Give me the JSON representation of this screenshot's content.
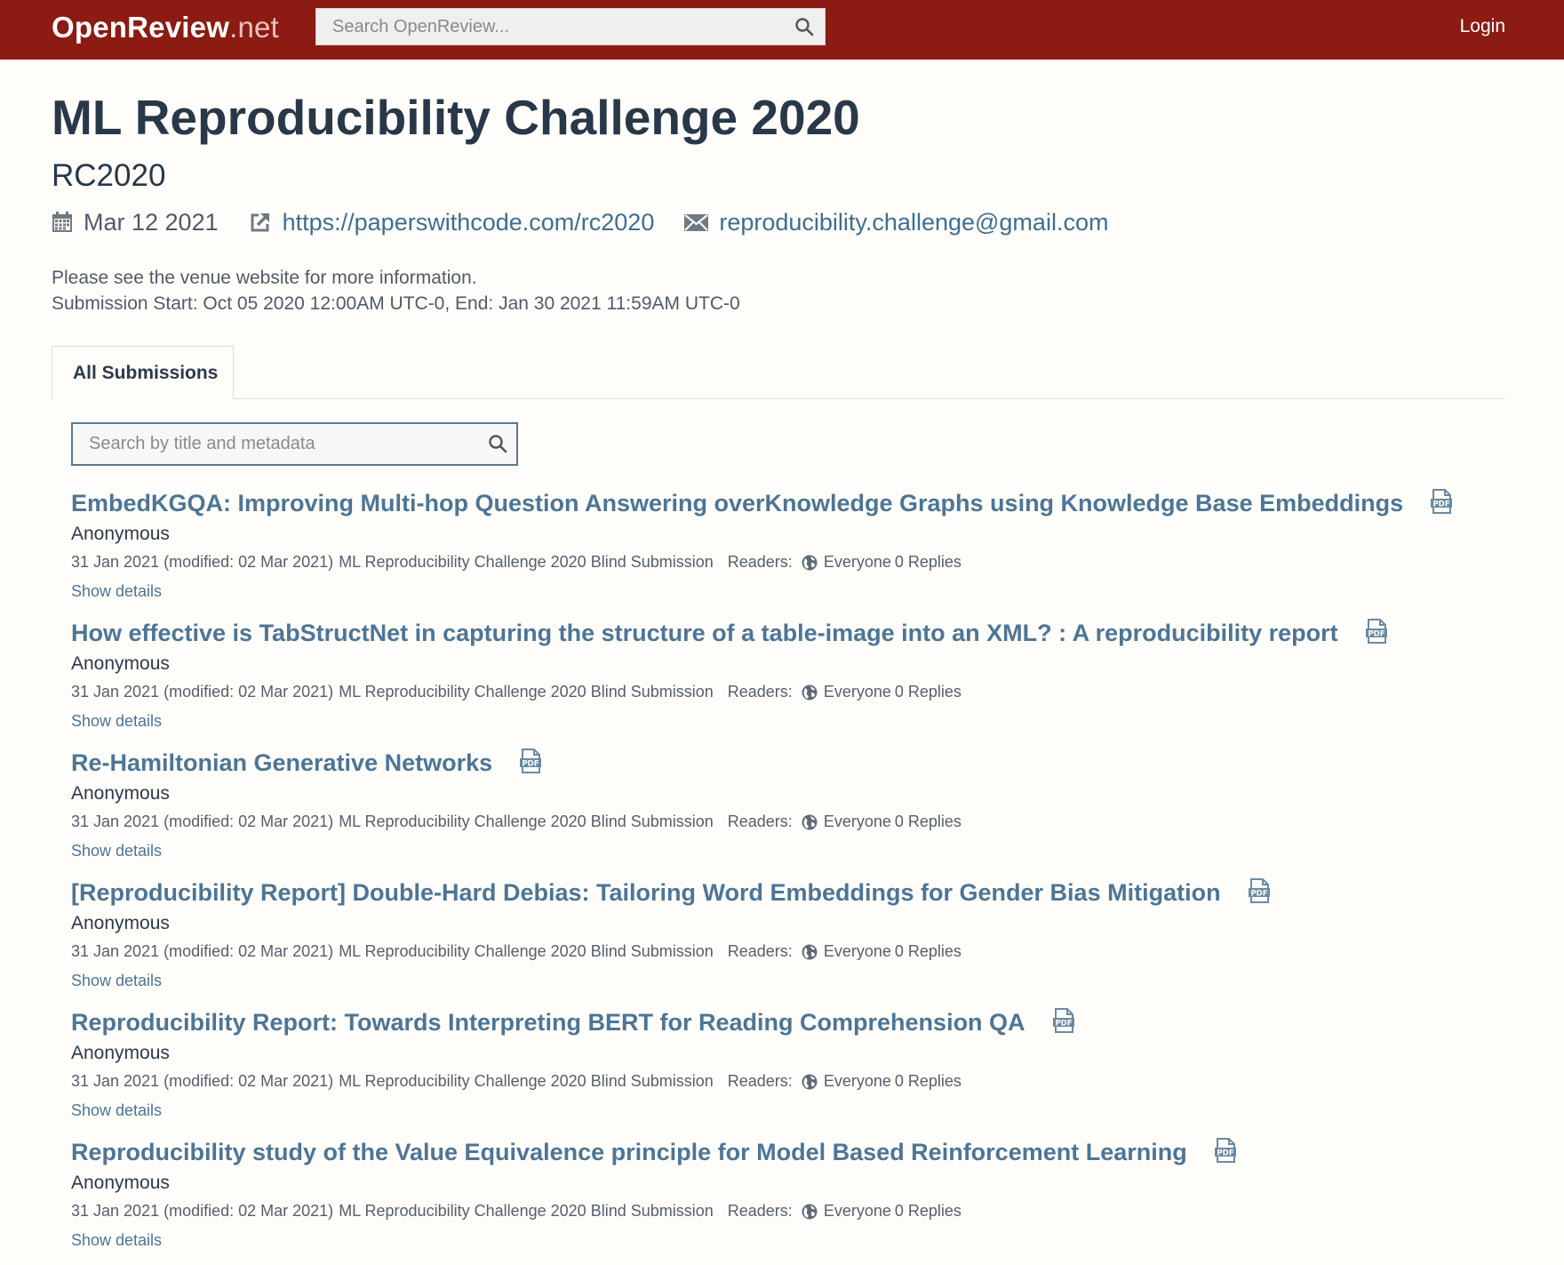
{
  "header": {
    "brand_main": "OpenReview",
    "brand_suffix": ".net",
    "search_placeholder": "Search OpenReview...",
    "login_label": "Login",
    "accent_color": "#8c1b13"
  },
  "venue": {
    "title": "ML Reproducibility Challenge 2020",
    "subtitle": "RC2020",
    "date": "Mar 12 2021",
    "website": "https://paperswithcode.com/rc2020",
    "email": "reproducibility.challenge@gmail.com",
    "description_line1": "Please see the venue website for more information.",
    "description_line2": "Submission Start: Oct 05 2020 12:00AM UTC-0, End: Jan 30 2021 11:59AM UTC-0"
  },
  "tabs": [
    {
      "label": "All Submissions",
      "active": true
    }
  ],
  "filter": {
    "placeholder": "Search by title and metadata"
  },
  "submissions": [
    {
      "title": "EmbedKGQA: Improving Multi-hop Question Answering overKnowledge Graphs using Knowledge Base Embeddings",
      "authors": "Anonymous",
      "dates": "31 Jan 2021 (modified: 02 Mar 2021)",
      "invitation": "ML Reproducibility Challenge 2020 Blind Submission",
      "readers_label": "Readers:",
      "readers": "Everyone",
      "replies": "0 Replies",
      "details_label": "Show details"
    },
    {
      "title": "How effective is TabStructNet in capturing the structure of a table-image into an XML? : A reproducibility report",
      "authors": "Anonymous",
      "dates": "31 Jan 2021 (modified: 02 Mar 2021)",
      "invitation": "ML Reproducibility Challenge 2020 Blind Submission",
      "readers_label": "Readers:",
      "readers": "Everyone",
      "replies": "0 Replies",
      "details_label": "Show details"
    },
    {
      "title": "Re-Hamiltonian Generative Networks",
      "authors": "Anonymous",
      "dates": "31 Jan 2021 (modified: 02 Mar 2021)",
      "invitation": "ML Reproducibility Challenge 2020 Blind Submission",
      "readers_label": "Readers:",
      "readers": "Everyone",
      "replies": "0 Replies",
      "details_label": "Show details"
    },
    {
      "title": "[Reproducibility Report] Double-Hard Debias: Tailoring Word Embeddings for Gender Bias Mitigation",
      "authors": "Anonymous",
      "dates": "31 Jan 2021 (modified: 02 Mar 2021)",
      "invitation": "ML Reproducibility Challenge 2020 Blind Submission",
      "readers_label": "Readers:",
      "readers": "Everyone",
      "replies": "0 Replies",
      "details_label": "Show details"
    },
    {
      "title": "Reproducibility Report: Towards Interpreting BERT for Reading Comprehension QA",
      "authors": "Anonymous",
      "dates": "31 Jan 2021 (modified: 02 Mar 2021)",
      "invitation": "ML Reproducibility Challenge 2020 Blind Submission",
      "readers_label": "Readers:",
      "readers": "Everyone",
      "replies": "0 Replies",
      "details_label": "Show details"
    },
    {
      "title": "Reproducibility study of the Value Equivalence principle for Model Based Reinforcement Learning",
      "authors": "Anonymous",
      "dates": "31 Jan 2021 (modified: 02 Mar 2021)",
      "invitation": "ML Reproducibility Challenge 2020 Blind Submission",
      "readers_label": "Readers:",
      "readers": "Everyone",
      "replies": "0 Replies",
      "details_label": "Show details"
    }
  ]
}
